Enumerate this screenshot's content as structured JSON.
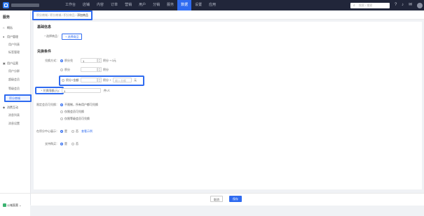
{
  "topbar": {
    "nav": [
      "工作台",
      "店铺",
      "内容",
      "订单",
      "营销",
      "用户",
      "分销",
      "服务",
      "数据",
      "设置",
      "应用"
    ],
    "active_index": 8,
    "search_placeholder": "搜索 / 搜索"
  },
  "sidebar": {
    "title": "服务",
    "overview": "概括",
    "groups": [
      {
        "label": "用户管理",
        "items": [
          "用户列表",
          "标签管理"
        ]
      },
      {
        "label": "用户运营",
        "items": [
          "用户分群",
          "超级会员",
          "等级会员",
          "积分商城"
        ]
      },
      {
        "label": "消费互动",
        "items": [
          "消息列表",
          "消息设置"
        ]
      }
    ],
    "active_item": "积分商城",
    "store_name": "公域直营"
  },
  "breadcrumb": {
    "items": [
      "积分商城",
      "积分商城",
      "积分商品"
    ],
    "current": "添加商品"
  },
  "form": {
    "basic_title": "基础信息",
    "select_label": "* 选择商品：",
    "select_button": "+ 选择商品",
    "rules_title": "兑换条件",
    "exchange_label": "兑换方式：",
    "options": [
      {
        "label": "积分兑",
        "value": "1",
        "unit": "积分 + 0元",
        "checked": true
      },
      {
        "label": "积分",
        "value": "",
        "unit": "积分",
        "checked": false
      },
      {
        "label": "积分+金额",
        "value": "",
        "unit": "积分 +",
        "price_placeholder": "输入金额",
        "price_unit": "元",
        "checked": false
      }
    ],
    "limit_label": "* 兑换限额(元)：",
    "limit_value": "1",
    "limit_unit": "件/人",
    "vip_label": "限定会员可兑换：",
    "vip_options": [
      "不限制，所有用户都可兑换",
      "仅限会员可兑换",
      "仅限等级会员可兑换"
    ],
    "display_label": "在积分中心展示：",
    "display_yes": "是",
    "display_no": "否",
    "display_link": "查看示例",
    "buy_label": "支持购买：",
    "buy_yes": "是",
    "buy_no": "否"
  },
  "footer": {
    "cancel": "取消",
    "save": "保存"
  }
}
